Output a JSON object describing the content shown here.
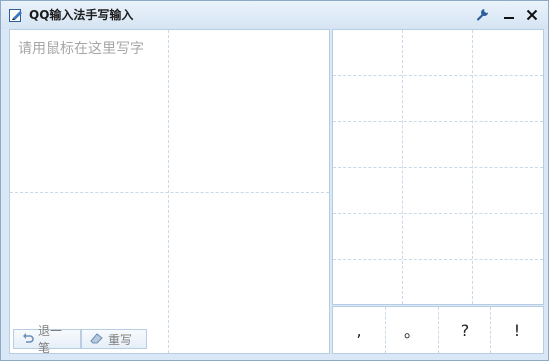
{
  "titlebar": {
    "title": "QQ输入法手写输入",
    "app_icon": "edit-icon",
    "buttons": {
      "settings_icon": "wrench-icon",
      "minimize_icon": "minimize-icon",
      "close_icon": "close-icon"
    }
  },
  "writing_area": {
    "hint": "请用鼠标在这里写字",
    "undo_label": "退一笔",
    "undo_icon": "undo-icon",
    "rewrite_label": "重写",
    "rewrite_icon": "eraser-icon"
  },
  "punctuation": [
    ",",
    "。",
    "?",
    "!"
  ],
  "colors": {
    "border": "#b7cde3",
    "grid": "#c9d9e8",
    "hint": "#a7a7a7",
    "title_bg": "#dbe8f5"
  }
}
